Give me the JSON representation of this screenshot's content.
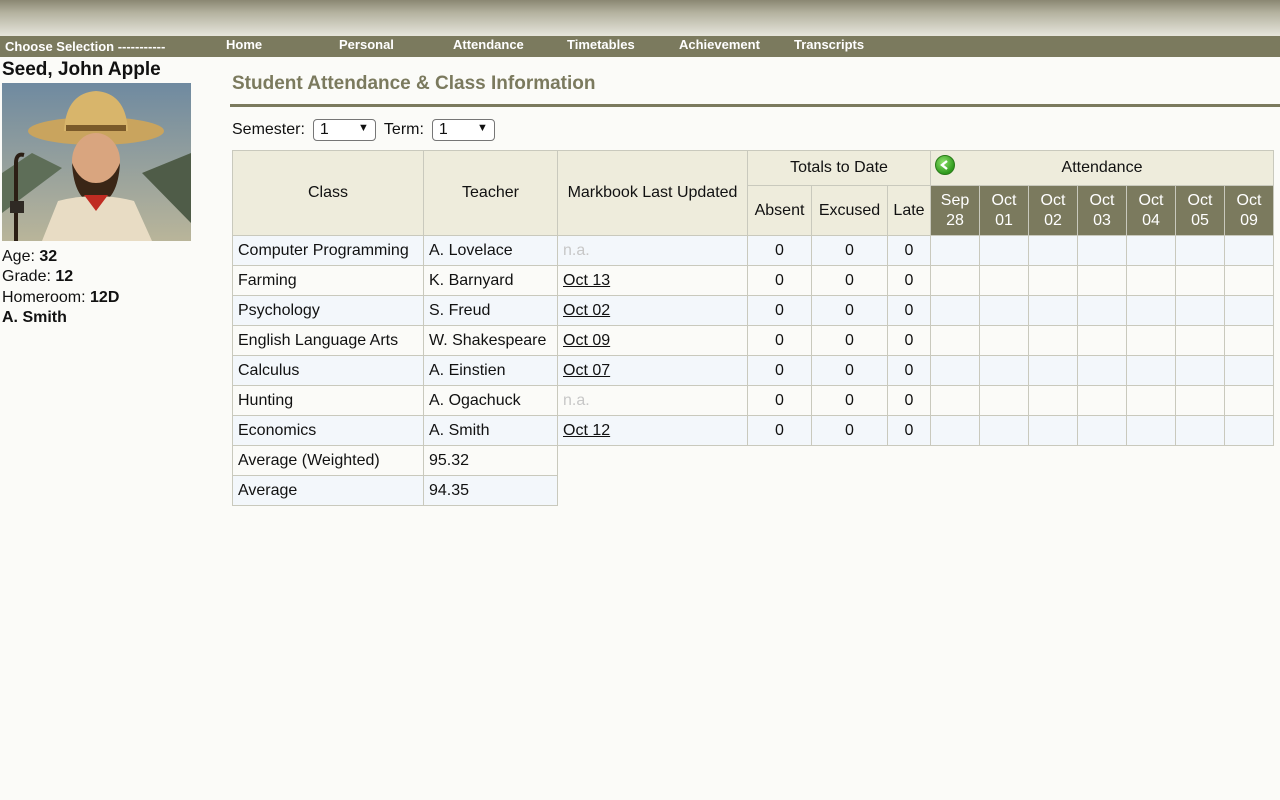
{
  "nav": {
    "choose": "Choose Selection -----------",
    "items": [
      "Home",
      "Personal",
      "Attendance",
      "Timetables",
      "Achievement",
      "Transcripts"
    ]
  },
  "student": {
    "name": "Seed, John Apple",
    "age_label": "Age:",
    "age": "32",
    "grade_label": "Grade:",
    "grade": "12",
    "homeroom_label": "Homeroom:",
    "homeroom": "12D",
    "advisor": "A. Smith"
  },
  "page": {
    "title": "Student Attendance & Class Information",
    "semester_label": "Semester:",
    "semester_value": "1",
    "term_label": "Term:",
    "term_value": "1"
  },
  "table": {
    "headers": {
      "class": "Class",
      "teacher": "Teacher",
      "markbook": "Markbook Last Updated",
      "totals": "Totals to Date",
      "absent": "Absent",
      "excused": "Excused",
      "late": "Late",
      "attendance": "Attendance"
    },
    "dates": [
      {
        "m": "Sep",
        "d": "28"
      },
      {
        "m": "Oct",
        "d": "01"
      },
      {
        "m": "Oct",
        "d": "02"
      },
      {
        "m": "Oct",
        "d": "03"
      },
      {
        "m": "Oct",
        "d": "04"
      },
      {
        "m": "Oct",
        "d": "05"
      },
      {
        "m": "Oct",
        "d": "09"
      }
    ],
    "rows": [
      {
        "class": "Computer Programming",
        "teacher": "A. Lovelace",
        "updated": "n.a.",
        "link": false,
        "absent": "0",
        "excused": "0",
        "late": "0"
      },
      {
        "class": "Farming",
        "teacher": "K. Barnyard",
        "updated": "Oct 13",
        "link": true,
        "absent": "0",
        "excused": "0",
        "late": "0"
      },
      {
        "class": "Psychology",
        "teacher": "S. Freud",
        "updated": "Oct 02",
        "link": true,
        "absent": "0",
        "excused": "0",
        "late": "0"
      },
      {
        "class": "English Language Arts",
        "teacher": "W. Shakespeare",
        "updated": "Oct 09",
        "link": true,
        "absent": "0",
        "excused": "0",
        "late": "0"
      },
      {
        "class": "Calculus",
        "teacher": "A. Einstien",
        "updated": "Oct 07",
        "link": true,
        "absent": "0",
        "excused": "0",
        "late": "0"
      },
      {
        "class": "Hunting",
        "teacher": "A. Ogachuck",
        "updated": "n.a.",
        "link": false,
        "absent": "0",
        "excused": "0",
        "late": "0"
      },
      {
        "class": "Economics",
        "teacher": "A. Smith",
        "updated": "Oct 12",
        "link": true,
        "absent": "0",
        "excused": "0",
        "late": "0"
      }
    ],
    "averages": [
      {
        "label": "Average (Weighted)",
        "value": "95.32"
      },
      {
        "label": "Average",
        "value": "94.35"
      }
    ]
  },
  "colors": {
    "nav": "#7b7a5e",
    "header_cell": "#eeecdc",
    "row_alt": "#f3f7fb"
  },
  "icons": {
    "back": "green-back-arrow-icon"
  }
}
